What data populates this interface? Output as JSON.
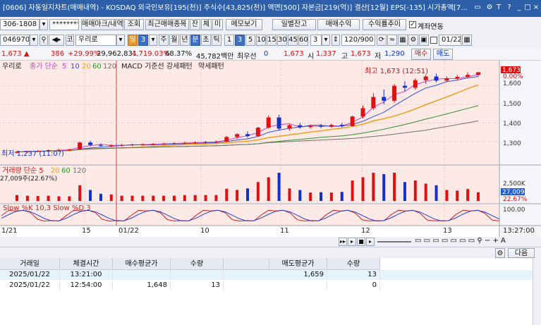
{
  "window": {
    "title": "[0606] 자동일지차트(매매내역) - KOSDAQ 외국인보유[195(천)] 주식수[43,825(천)] 액면[500] 자본금[219(억)] 결산[12월] EPS[-135] 시가총액[7..."
  },
  "toolbar1": {
    "account": "306-1808",
    "password": "********",
    "btn_trade_mark": "매매마크/내역",
    "btn_query": "조회",
    "btn_recent": "최근매매종목",
    "btn_balance": "잔",
    "btn_fill": "체",
    "btn_mi": "미",
    "btn_memo": "메모보기",
    "btn_daily_balance": "일별잔고",
    "btn_trade_profit": "매매수익",
    "btn_profit_trend": "수익률추이",
    "chk_account_link": "계좌연동"
  },
  "toolbar2": {
    "code": "046970",
    "market": "코",
    "stock_name": "우리로",
    "period_day": "일",
    "period_count": "3",
    "period_tabs": [
      "주",
      "월",
      "년",
      "분",
      "초",
      "틱"
    ],
    "period_active": "분",
    "minute_opts": [
      "1",
      "3",
      "5",
      "10",
      "15",
      "30",
      "45",
      "60"
    ],
    "minute_active": "3",
    "count_value": "3",
    "view_count": "120/900",
    "date_value": "01/22"
  },
  "quote": {
    "price": "1,673",
    "change": "386",
    "change_pct": "+29.99%",
    "volume": "29,962,831",
    "volume_ratio": "4,719.03%",
    "turnover": "68.37%",
    "amount": "45,782백만",
    "pref_label": "최우선",
    "pref_value": "0",
    "bid": "1,673",
    "open_label": "시",
    "open": "1,337",
    "high_label": "고",
    "high": "1,673",
    "low_label": "저",
    "low": "1,290",
    "buy_btn": "매수",
    "sell_btn": "매도"
  },
  "chart": {
    "legend_price": "우리로",
    "legend_ma_label": "종가 단순",
    "legend_ma": [
      "5",
      "10",
      "20",
      "60",
      "120"
    ],
    "legend_macd": "MACD 기준선 강세패턴",
    "legend_macd2": "약세패턴",
    "annot_high": "최고 1,673 (12:51)",
    "annot_low": "최저 1,237 (11:0?)",
    "price_axis": [
      "1,673",
      "0.00%",
      "1,600",
      "1,500",
      "1,400",
      "1,300"
    ],
    "vol_legend": "거래량 단순 5",
    "vol_legend_ma": [
      "20",
      "60",
      "120"
    ],
    "vol_value": "27,009주(22.67%)",
    "vol_axis": [
      "2,500K",
      "27,009",
      "22.67%"
    ],
    "stoch_legend": "Slow %K 10,3   Slow %D 3",
    "stoch_axis": "100.00",
    "x_labels": [
      "1/21",
      "15",
      "01/22",
      "10",
      "11",
      "12",
      "13"
    ],
    "time_label": "13:27:00"
  },
  "nav": {
    "next_btn": "다음"
  },
  "table": {
    "headers": [
      "거래일",
      "체결시간",
      "매수평균가",
      "수량",
      "",
      "매도평균가",
      "수량"
    ],
    "rows": [
      [
        "2025/01/22",
        "13:21:00",
        "",
        "",
        "",
        "1,659",
        "13"
      ],
      [
        "2025/01/22",
        "12:54:00",
        "1,648",
        "13",
        "",
        "",
        "0"
      ]
    ]
  },
  "chart_data": {
    "type": "candlestick",
    "title": "",
    "ylim": [
      1220,
      1690
    ],
    "candles_ohlc": [
      [
        1240,
        1250,
        1236,
        1245
      ],
      [
        1245,
        1252,
        1240,
        1248
      ],
      [
        1248,
        1255,
        1244,
        1250
      ],
      [
        1250,
        1258,
        1246,
        1254
      ],
      [
        1254,
        1260,
        1250,
        1256
      ],
      [
        1256,
        1262,
        1252,
        1258
      ],
      [
        1258,
        1300,
        1255,
        1295
      ],
      [
        1295,
        1305,
        1275,
        1282
      ],
      [
        1282,
        1290,
        1272,
        1278
      ],
      [
        1278,
        1286,
        1270,
        1280
      ],
      [
        1280,
        1286,
        1274,
        1282
      ],
      [
        1282,
        1288,
        1276,
        1284
      ],
      [
        1284,
        1290,
        1278,
        1286
      ],
      [
        1286,
        1292,
        1280,
        1288
      ],
      [
        1288,
        1294,
        1282,
        1290
      ],
      [
        1290,
        1296,
        1284,
        1292
      ],
      [
        1292,
        1300,
        1286,
        1294
      ],
      [
        1294,
        1302,
        1288,
        1296
      ],
      [
        1296,
        1304,
        1290,
        1298
      ],
      [
        1298,
        1306,
        1292,
        1300
      ],
      [
        1300,
        1330,
        1296,
        1325
      ],
      [
        1325,
        1345,
        1315,
        1340
      ],
      [
        1340,
        1355,
        1320,
        1330
      ],
      [
        1330,
        1380,
        1325,
        1375
      ],
      [
        1375,
        1440,
        1370,
        1430
      ],
      [
        1430,
        1445,
        1360,
        1370
      ],
      [
        1370,
        1395,
        1360,
        1388
      ],
      [
        1388,
        1400,
        1370,
        1378
      ],
      [
        1378,
        1392,
        1370,
        1385
      ],
      [
        1385,
        1395,
        1372,
        1380
      ],
      [
        1380,
        1396,
        1374,
        1390
      ],
      [
        1390,
        1400,
        1376,
        1384
      ],
      [
        1384,
        1440,
        1380,
        1435
      ],
      [
        1435,
        1495,
        1425,
        1480
      ],
      [
        1480,
        1560,
        1470,
        1540
      ],
      [
        1540,
        1580,
        1500,
        1520
      ],
      [
        1520,
        1610,
        1510,
        1600
      ],
      [
        1600,
        1625,
        1570,
        1590
      ],
      [
        1590,
        1640,
        1580,
        1630
      ],
      [
        1630,
        1660,
        1610,
        1650
      ],
      [
        1650,
        1665,
        1620,
        1628
      ],
      [
        1628,
        1650,
        1620,
        1640
      ],
      [
        1640,
        1658,
        1630,
        1648
      ],
      [
        1648,
        1673,
        1640,
        1659
      ],
      [
        1659,
        1673,
        1650,
        1673
      ]
    ]
  }
}
